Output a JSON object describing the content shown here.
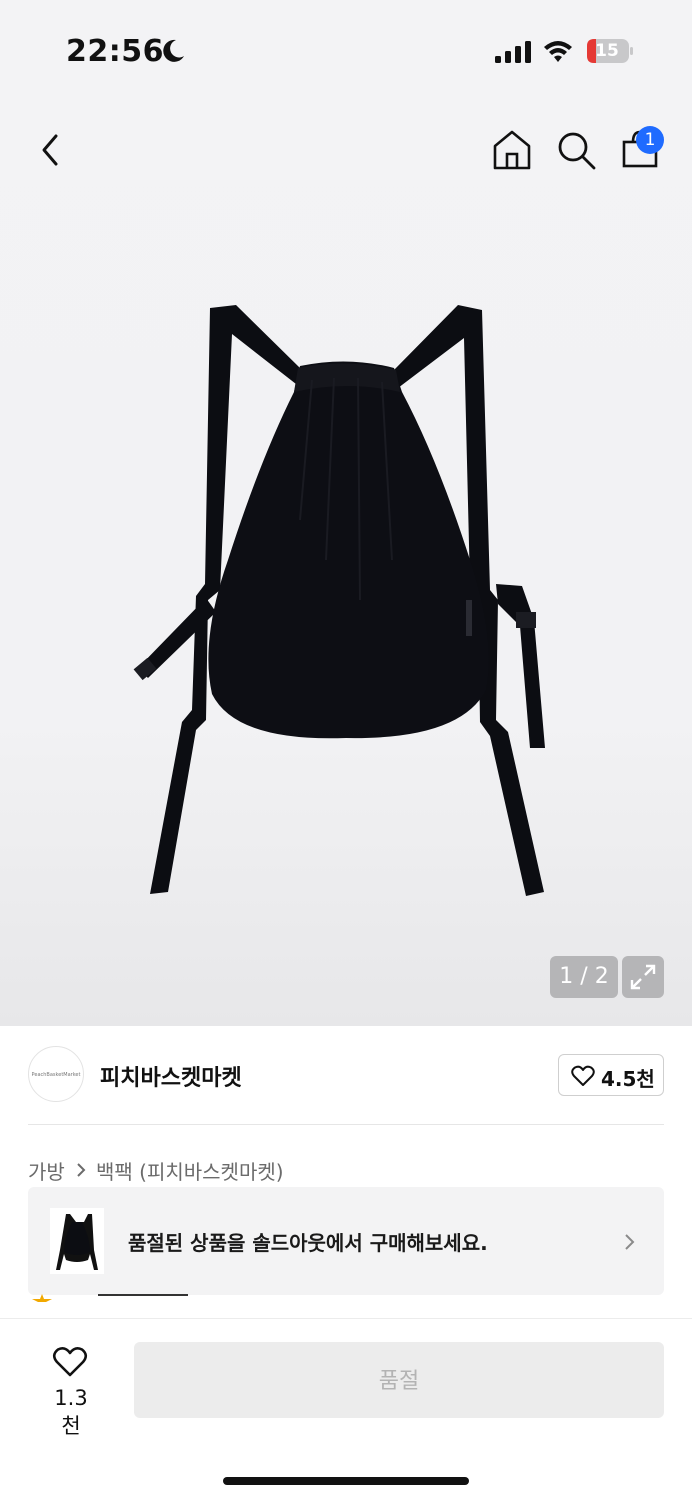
{
  "status_bar": {
    "time": "22:56",
    "battery": "15",
    "icons": [
      "moon-icon",
      "cellular-signal-icon",
      "wifi-icon",
      "battery-icon"
    ]
  },
  "nav": {
    "icons": [
      "back-chevron-icon",
      "home-icon",
      "search-icon",
      "shopping-bag-icon"
    ],
    "cart_badge": "1"
  },
  "gallery": {
    "pager": "1 / 2",
    "current_page": 1,
    "total_pages": 2
  },
  "shop": {
    "logo_text": "PeachBasketMarket",
    "name": "피치바스켓마켓",
    "likes": "4.5천"
  },
  "breadcrumb": {
    "category": "가방",
    "subcategory": "백팩 (피치바스켓마켓)"
  },
  "soldout_banner": {
    "text": "품절된 상품을 솔드아웃에서 구매해보세요."
  },
  "bottom_bar": {
    "wish_count": "1.3천",
    "buy_label": "품절"
  },
  "colors": {
    "badge": "#1f6bff",
    "battery_low": "#e53935",
    "disabled_button": "#ececec",
    "disabled_text": "#b3b3b3"
  }
}
